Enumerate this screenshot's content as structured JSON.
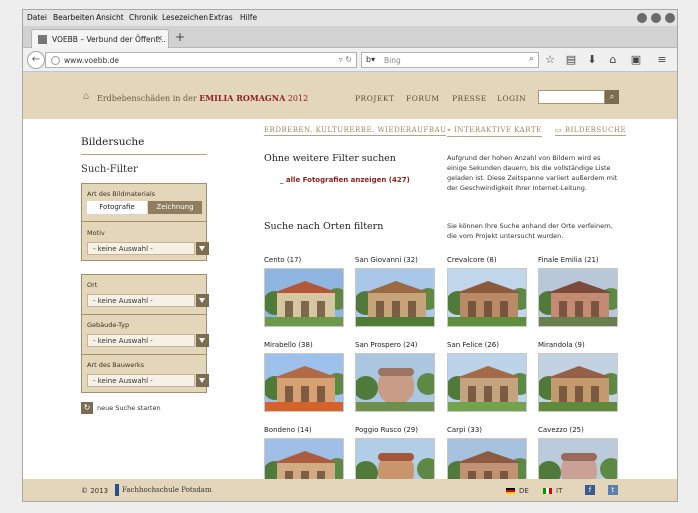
{
  "browser": {
    "menu": [
      "Datei",
      "Bearbeiten",
      "Ansicht",
      "Chronik",
      "Lesezeichen",
      "Extras",
      "Hilfe"
    ],
    "tab_title": "VOEBB – Verbund der Öffent…",
    "url": "www.voebb.de",
    "search_engine": "Bing",
    "search_placeholder": "Bing"
  },
  "header": {
    "title_prefix": "Erdbebenschäden in der",
    "title_region": "EMILIA ROMAGNA",
    "title_year": "2012",
    "nav": [
      "PROJEKT",
      "FORUM",
      "PRESSE",
      "LOGIN"
    ],
    "search_value": ""
  },
  "subnav": {
    "tagline": "ERDBEBEN. KULTURERBE. WIEDERAUFBAU",
    "map": "INTERAKTIVE KARTE",
    "imagesearch": "BILDERSUCHE"
  },
  "sidebar": {
    "title": "Bildersuche",
    "filter_title": "Such-Filter",
    "material_label": "Art des Bildmaterials",
    "material_options": [
      "Fotografie",
      "Zeichnung"
    ],
    "motiv_label": "Motiv",
    "motiv_value": "- keine Auswahl -",
    "ort_label": "Ort",
    "ort_value": "- keine Auswahl -",
    "gebaeude_label": "Gebäude-Typ",
    "gebaeude_value": "- keine Auswahl -",
    "bauwerk_label": "Art des Bauwerks",
    "bauwerk_value": "- keine Auswahl -",
    "new_search": "neue Suche starten"
  },
  "main": {
    "nofilter_title": "Ohne weitere Filter suchen",
    "all_photos_link": "_ alle Fotografien anzeigen (427)",
    "nofilter_info": "Aufgrund der hohen Anzahl von Bildern wird es einige Sekunden dauern, bis die vollständige Liste geladen ist. Diese Zeitspanne variiert außerdem mit der Geschwindigkeit Ihrer Internet-Leitung.",
    "places_title": "Suche nach Orten filtern",
    "places_info": "Sie  können Ihre Suche anhand der Orte verfeinern, die vom Projekt untersucht wurden.",
    "places": [
      {
        "label": "Cento (17)"
      },
      {
        "label": "San Giovanni (32)"
      },
      {
        "label": "Crevalcore (8)"
      },
      {
        "label": "Finale Emilia (21)"
      },
      {
        "label": "Mirabello (38)"
      },
      {
        "label": "San Prospero (24)"
      },
      {
        "label": "San Felice (26)"
      },
      {
        "label": "Mirandola (9)"
      },
      {
        "label": "Bondeno (14)"
      },
      {
        "label": "Poggio Rusco (29)"
      },
      {
        "label": "Carpi (33)"
      },
      {
        "label": "Cavezzo (25)"
      }
    ]
  },
  "footer": {
    "copyright": "© 2013",
    "institution": "Fachhochschule Potsdam",
    "lang_de": "DE",
    "lang_it": "IT"
  }
}
